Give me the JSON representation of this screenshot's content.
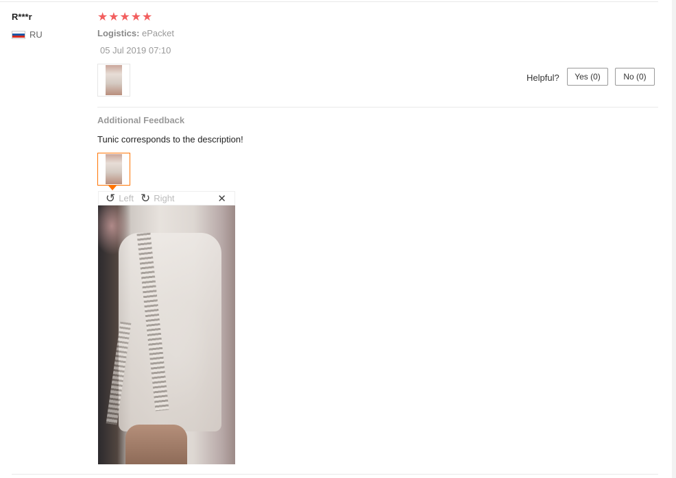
{
  "review": {
    "user": "R***r",
    "country_code": "RU",
    "flag_colors": [
      "#ffffff",
      "#1c57a5",
      "#d52b1e"
    ],
    "rating_stars": 5,
    "rating_max": 5,
    "star_color": "#f25e5e",
    "logistics_label": "Logistics:",
    "logistics_value": "ePacket",
    "date": "05 Jul 2019 07:10",
    "helpful_label": "Helpful?",
    "yes_label": "Yes (0)",
    "no_label": "No (0)"
  },
  "additional": {
    "title": "Additional Feedback",
    "text": "Tunic corresponds to the description!",
    "selected_thumb_border": "#ff7300"
  },
  "viewer": {
    "left_icon": "rotate-left-icon",
    "left_label": "Left",
    "right_icon": "rotate-right-icon",
    "right_label": "Right",
    "close_icon": "close-icon",
    "close_glyph": "✕"
  }
}
